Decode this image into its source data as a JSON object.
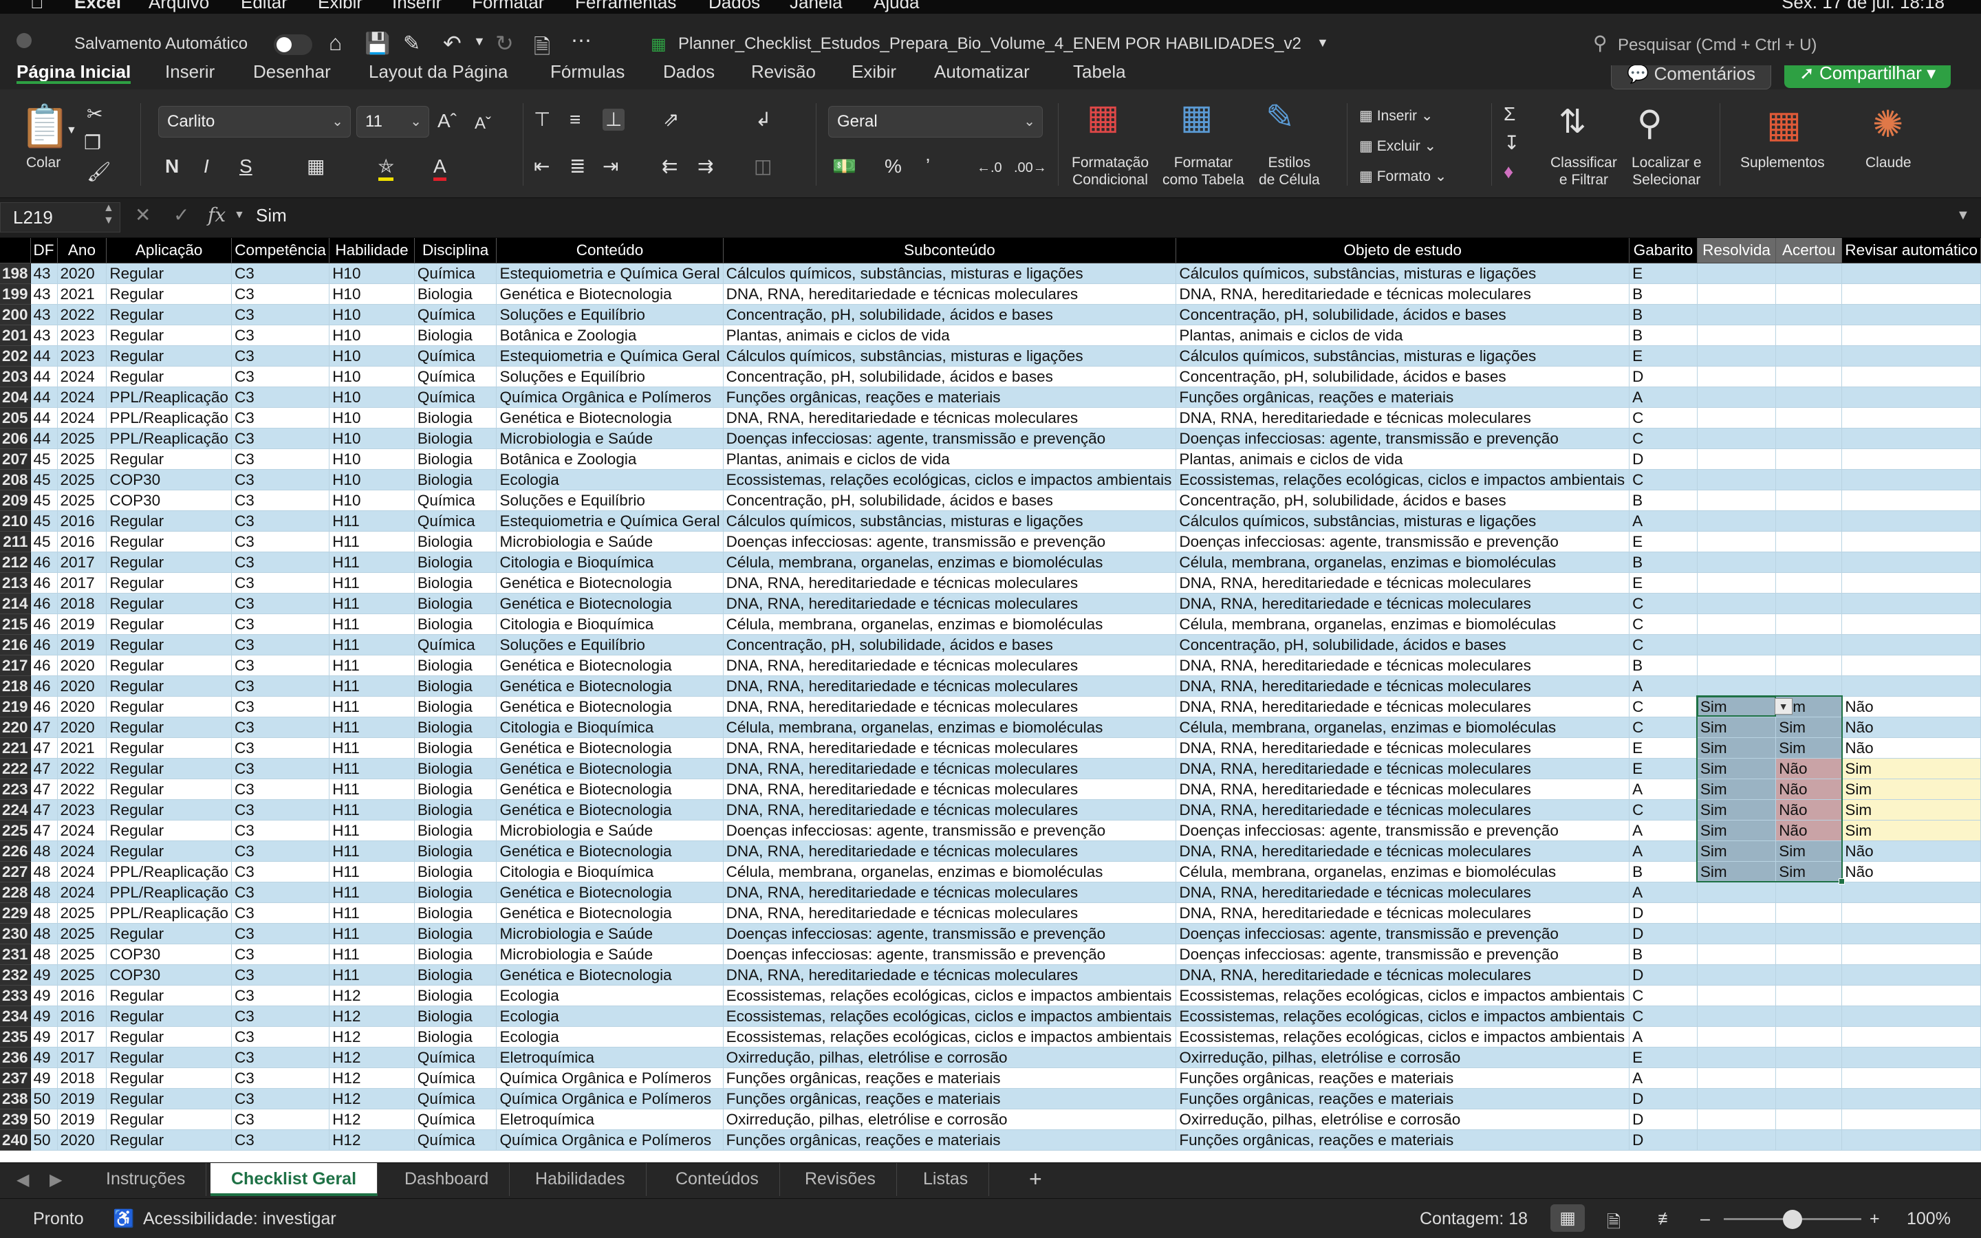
{
  "menubar": {
    "items": [
      "Excel",
      "Arquivo",
      "Editar",
      "Exibir",
      "Inserir",
      "Formatar",
      "Ferramentas",
      "Dados",
      "Janela",
      "Ajuda"
    ],
    "clock": "Sex. 17 de jul. 18:18"
  },
  "titlebar": {
    "autosave_label": "Salvamento Automático",
    "filename": "Planner_Checklist_Estudos_Prepara_Bio_Volume_4_ENEM POR HABILIDADES_v2",
    "search_placeholder": "Pesquisar (Cmd + Ctrl + U)"
  },
  "ribbon_tabs": [
    "Página Inicial",
    "Inserir",
    "Desenhar",
    "Layout da Página",
    "Fórmulas",
    "Dados",
    "Revisão",
    "Exibir",
    "Automatizar",
    "Tabela"
  ],
  "ribbon_actions": {
    "comments": "Comentários",
    "share": "Compartilhar"
  },
  "ribbon": {
    "paste": "Colar",
    "font_name": "Carlito",
    "font_size": "11",
    "number_format": "Geral",
    "bold": "N",
    "italic": "I",
    "underline": "S",
    "cond_format": [
      "Formatação",
      "Condicional"
    ],
    "format_table": [
      "Formatar",
      "como Tabela"
    ],
    "cell_styles": [
      "Estilos",
      "de Célula"
    ],
    "insert": "Inserir",
    "delete": "Excluir",
    "format": "Formato",
    "sort_filter": [
      "Classificar",
      "e Filtrar"
    ],
    "find_select": [
      "Localizar e",
      "Selecionar"
    ],
    "addins": "Suplementos",
    "claude": "Claude"
  },
  "formula_bar": {
    "name_box": "L219",
    "fx": "fx",
    "value": "Sim"
  },
  "columns": [
    "DF",
    "Ano",
    "Aplicação",
    "Competência",
    "Habilidade",
    "Disciplina",
    "Conteúdo",
    "Subconteúdo",
    "Objeto de estudo",
    "Gabarito",
    "Resolvida",
    "Acertou",
    "Revisar automático"
  ],
  "rows": [
    [
      "198",
      "43",
      "2020",
      "Regular",
      "C3",
      "H10",
      "Química",
      "Estequiometria e Química Geral",
      "Cálculos químicos, substâncias, misturas e ligações",
      "Cálculos químicos, substâncias, misturas e ligações",
      "E",
      "",
      "",
      ""
    ],
    [
      "199",
      "43",
      "2021",
      "Regular",
      "C3",
      "H10",
      "Biologia",
      "Genética e Biotecnologia",
      "DNA, RNA, hereditariedade e técnicas moleculares",
      "DNA, RNA, hereditariedade e técnicas moleculares",
      "B",
      "",
      "",
      ""
    ],
    [
      "200",
      "43",
      "2022",
      "Regular",
      "C3",
      "H10",
      "Química",
      "Soluções e Equilíbrio",
      "Concentração, pH, solubilidade, ácidos e bases",
      "Concentração, pH, solubilidade, ácidos e bases",
      "B",
      "",
      "",
      ""
    ],
    [
      "201",
      "43",
      "2023",
      "Regular",
      "C3",
      "H10",
      "Biologia",
      "Botânica e Zoologia",
      "Plantas, animais e ciclos de vida",
      "Plantas, animais e ciclos de vida",
      "B",
      "",
      "",
      ""
    ],
    [
      "202",
      "44",
      "2023",
      "Regular",
      "C3",
      "H10",
      "Química",
      "Estequiometria e Química Geral",
      "Cálculos químicos, substâncias, misturas e ligações",
      "Cálculos químicos, substâncias, misturas e ligações",
      "E",
      "",
      "",
      ""
    ],
    [
      "203",
      "44",
      "2024",
      "Regular",
      "C3",
      "H10",
      "Química",
      "Soluções e Equilíbrio",
      "Concentração, pH, solubilidade, ácidos e bases",
      "Concentração, pH, solubilidade, ácidos e bases",
      "D",
      "",
      "",
      ""
    ],
    [
      "204",
      "44",
      "2024",
      "PPL/Reaplicação",
      "C3",
      "H10",
      "Química",
      "Química Orgânica e Polímeros",
      "Funções orgânicas, reações e materiais",
      "Funções orgânicas, reações e materiais",
      "A",
      "",
      "",
      ""
    ],
    [
      "205",
      "44",
      "2024",
      "PPL/Reaplicação",
      "C3",
      "H10",
      "Biologia",
      "Genética e Biotecnologia",
      "DNA, RNA, hereditariedade e técnicas moleculares",
      "DNA, RNA, hereditariedade e técnicas moleculares",
      "C",
      "",
      "",
      ""
    ],
    [
      "206",
      "44",
      "2025",
      "PPL/Reaplicação",
      "C3",
      "H10",
      "Biologia",
      "Microbiologia e Saúde",
      "Doenças infecciosas: agente, transmissão e prevenção",
      "Doenças infecciosas: agente, transmissão e prevenção",
      "C",
      "",
      "",
      ""
    ],
    [
      "207",
      "45",
      "2025",
      "Regular",
      "C3",
      "H10",
      "Biologia",
      "Botânica e Zoologia",
      "Plantas, animais e ciclos de vida",
      "Plantas, animais e ciclos de vida",
      "D",
      "",
      "",
      ""
    ],
    [
      "208",
      "45",
      "2025",
      "COP30",
      "C3",
      "H10",
      "Biologia",
      "Ecologia",
      "Ecossistemas, relações ecológicas, ciclos e impactos ambientais",
      "Ecossistemas, relações ecológicas, ciclos e impactos ambientais",
      "C",
      "",
      "",
      ""
    ],
    [
      "209",
      "45",
      "2025",
      "COP30",
      "C3",
      "H10",
      "Química",
      "Soluções e Equilíbrio",
      "Concentração, pH, solubilidade, ácidos e bases",
      "Concentração, pH, solubilidade, ácidos e bases",
      "B",
      "",
      "",
      ""
    ],
    [
      "210",
      "45",
      "2016",
      "Regular",
      "C3",
      "H11",
      "Química",
      "Estequiometria e Química Geral",
      "Cálculos químicos, substâncias, misturas e ligações",
      "Cálculos químicos, substâncias, misturas e ligações",
      "A",
      "",
      "",
      ""
    ],
    [
      "211",
      "45",
      "2016",
      "Regular",
      "C3",
      "H11",
      "Biologia",
      "Microbiologia e Saúde",
      "Doenças infecciosas: agente, transmissão e prevenção",
      "Doenças infecciosas: agente, transmissão e prevenção",
      "E",
      "",
      "",
      ""
    ],
    [
      "212",
      "46",
      "2017",
      "Regular",
      "C3",
      "H11",
      "Biologia",
      "Citologia e Bioquímica",
      "Célula, membrana, organelas, enzimas e biomoléculas",
      "Célula, membrana, organelas, enzimas e biomoléculas",
      "B",
      "",
      "",
      ""
    ],
    [
      "213",
      "46",
      "2017",
      "Regular",
      "C3",
      "H11",
      "Biologia",
      "Genética e Biotecnologia",
      "DNA, RNA, hereditariedade e técnicas moleculares",
      "DNA, RNA, hereditariedade e técnicas moleculares",
      "E",
      "",
      "",
      ""
    ],
    [
      "214",
      "46",
      "2018",
      "Regular",
      "C3",
      "H11",
      "Biologia",
      "Genética e Biotecnologia",
      "DNA, RNA, hereditariedade e técnicas moleculares",
      "DNA, RNA, hereditariedade e técnicas moleculares",
      "C",
      "",
      "",
      ""
    ],
    [
      "215",
      "46",
      "2019",
      "Regular",
      "C3",
      "H11",
      "Biologia",
      "Citologia e Bioquímica",
      "Célula, membrana, organelas, enzimas e biomoléculas",
      "Célula, membrana, organelas, enzimas e biomoléculas",
      "C",
      "",
      "",
      ""
    ],
    [
      "216",
      "46",
      "2019",
      "Regular",
      "C3",
      "H11",
      "Química",
      "Soluções e Equilíbrio",
      "Concentração, pH, solubilidade, ácidos e bases",
      "Concentração, pH, solubilidade, ácidos e bases",
      "C",
      "",
      "",
      ""
    ],
    [
      "217",
      "46",
      "2020",
      "Regular",
      "C3",
      "H11",
      "Biologia",
      "Genética e Biotecnologia",
      "DNA, RNA, hereditariedade e técnicas moleculares",
      "DNA, RNA, hereditariedade e técnicas moleculares",
      "B",
      "",
      "",
      ""
    ],
    [
      "218",
      "46",
      "2020",
      "Regular",
      "C3",
      "H11",
      "Biologia",
      "Genética e Biotecnologia",
      "DNA, RNA, hereditariedade e técnicas moleculares",
      "DNA, RNA, hereditariedade e técnicas moleculares",
      "A",
      "",
      "",
      ""
    ],
    [
      "219",
      "46",
      "2020",
      "Regular",
      "C3",
      "H11",
      "Biologia",
      "Genética e Biotecnologia",
      "DNA, RNA, hereditariedade e técnicas moleculares",
      "DNA, RNA, hereditariedade e técnicas moleculares",
      "C",
      "Sim",
      "Sim",
      "Não"
    ],
    [
      "220",
      "47",
      "2020",
      "Regular",
      "C3",
      "H11",
      "Biologia",
      "Citologia e Bioquímica",
      "Célula, membrana, organelas, enzimas e biomoléculas",
      "Célula, membrana, organelas, enzimas e biomoléculas",
      "C",
      "Sim",
      "Sim",
      "Não"
    ],
    [
      "221",
      "47",
      "2021",
      "Regular",
      "C3",
      "H11",
      "Biologia",
      "Genética e Biotecnologia",
      "DNA, RNA, hereditariedade e técnicas moleculares",
      "DNA, RNA, hereditariedade e técnicas moleculares",
      "E",
      "Sim",
      "Sim",
      "Não"
    ],
    [
      "222",
      "47",
      "2022",
      "Regular",
      "C3",
      "H11",
      "Biologia",
      "Genética e Biotecnologia",
      "DNA, RNA, hereditariedade e técnicas moleculares",
      "DNA, RNA, hereditariedade e técnicas moleculares",
      "E",
      "Sim",
      "Não",
      "Sim"
    ],
    [
      "223",
      "47",
      "2022",
      "Regular",
      "C3",
      "H11",
      "Biologia",
      "Genética e Biotecnologia",
      "DNA, RNA, hereditariedade e técnicas moleculares",
      "DNA, RNA, hereditariedade e técnicas moleculares",
      "A",
      "Sim",
      "Não",
      "Sim"
    ],
    [
      "224",
      "47",
      "2023",
      "Regular",
      "C3",
      "H11",
      "Biologia",
      "Genética e Biotecnologia",
      "DNA, RNA, hereditariedade e técnicas moleculares",
      "DNA, RNA, hereditariedade e técnicas moleculares",
      "C",
      "Sim",
      "Não",
      "Sim"
    ],
    [
      "225",
      "47",
      "2024",
      "Regular",
      "C3",
      "H11",
      "Biologia",
      "Microbiologia e Saúde",
      "Doenças infecciosas: agente, transmissão e prevenção",
      "Doenças infecciosas: agente, transmissão e prevenção",
      "A",
      "Sim",
      "Não",
      "Sim"
    ],
    [
      "226",
      "48",
      "2024",
      "Regular",
      "C3",
      "H11",
      "Biologia",
      "Genética e Biotecnologia",
      "DNA, RNA, hereditariedade e técnicas moleculares",
      "DNA, RNA, hereditariedade e técnicas moleculares",
      "A",
      "Sim",
      "Sim",
      "Não"
    ],
    [
      "227",
      "48",
      "2024",
      "PPL/Reaplicação",
      "C3",
      "H11",
      "Biologia",
      "Citologia e Bioquímica",
      "Célula, membrana, organelas, enzimas e biomoléculas",
      "Célula, membrana, organelas, enzimas e biomoléculas",
      "B",
      "Sim",
      "Sim",
      "Não"
    ],
    [
      "228",
      "48",
      "2024",
      "PPL/Reaplicação",
      "C3",
      "H11",
      "Biologia",
      "Genética e Biotecnologia",
      "DNA, RNA, hereditariedade e técnicas moleculares",
      "DNA, RNA, hereditariedade e técnicas moleculares",
      "A",
      "",
      "",
      ""
    ],
    [
      "229",
      "48",
      "2025",
      "PPL/Reaplicação",
      "C3",
      "H11",
      "Biologia",
      "Genética e Biotecnologia",
      "DNA, RNA, hereditariedade e técnicas moleculares",
      "DNA, RNA, hereditariedade e técnicas moleculares",
      "D",
      "",
      "",
      ""
    ],
    [
      "230",
      "48",
      "2025",
      "Regular",
      "C3",
      "H11",
      "Biologia",
      "Microbiologia e Saúde",
      "Doenças infecciosas: agente, transmissão e prevenção",
      "Doenças infecciosas: agente, transmissão e prevenção",
      "D",
      "",
      "",
      ""
    ],
    [
      "231",
      "48",
      "2025",
      "COP30",
      "C3",
      "H11",
      "Biologia",
      "Microbiologia e Saúde",
      "Doenças infecciosas: agente, transmissão e prevenção",
      "Doenças infecciosas: agente, transmissão e prevenção",
      "B",
      "",
      "",
      ""
    ],
    [
      "232",
      "49",
      "2025",
      "COP30",
      "C3",
      "H11",
      "Biologia",
      "Genética e Biotecnologia",
      "DNA, RNA, hereditariedade e técnicas moleculares",
      "DNA, RNA, hereditariedade e técnicas moleculares",
      "D",
      "",
      "",
      ""
    ],
    [
      "233",
      "49",
      "2016",
      "Regular",
      "C3",
      "H12",
      "Biologia",
      "Ecologia",
      "Ecossistemas, relações ecológicas, ciclos e impactos ambientais",
      "Ecossistemas, relações ecológicas, ciclos e impactos ambientais",
      "C",
      "",
      "",
      ""
    ],
    [
      "234",
      "49",
      "2016",
      "Regular",
      "C3",
      "H12",
      "Biologia",
      "Ecologia",
      "Ecossistemas, relações ecológicas, ciclos e impactos ambientais",
      "Ecossistemas, relações ecológicas, ciclos e impactos ambientais",
      "C",
      "",
      "",
      ""
    ],
    [
      "235",
      "49",
      "2017",
      "Regular",
      "C3",
      "H12",
      "Biologia",
      "Ecologia",
      "Ecossistemas, relações ecológicas, ciclos e impactos ambientais",
      "Ecossistemas, relações ecológicas, ciclos e impactos ambientais",
      "A",
      "",
      "",
      ""
    ],
    [
      "236",
      "49",
      "2017",
      "Regular",
      "C3",
      "H12",
      "Química",
      "Eletroquímica",
      "Oxirredução, pilhas, eletrólise e corrosão",
      "Oxirredução, pilhas, eletrólise e corrosão",
      "E",
      "",
      "",
      ""
    ],
    [
      "237",
      "49",
      "2018",
      "Regular",
      "C3",
      "H12",
      "Química",
      "Química Orgânica e Polímeros",
      "Funções orgânicas, reações e materiais",
      "Funções orgânicas, reações e materiais",
      "A",
      "",
      "",
      ""
    ],
    [
      "238",
      "50",
      "2019",
      "Regular",
      "C3",
      "H12",
      "Química",
      "Química Orgânica e Polímeros",
      "Funções orgânicas, reações e materiais",
      "Funções orgânicas, reações e materiais",
      "D",
      "",
      "",
      ""
    ],
    [
      "239",
      "50",
      "2019",
      "Regular",
      "C3",
      "H12",
      "Química",
      "Eletroquímica",
      "Oxirredução, pilhas, eletrólise e corrosão",
      "Oxirredução, pilhas, eletrólise e corrosão",
      "D",
      "",
      "",
      ""
    ],
    [
      "240",
      "50",
      "2020",
      "Regular",
      "C3",
      "H12",
      "Química",
      "Química Orgânica e Polímeros",
      "Funções orgânicas, reações e materiais",
      "Funções orgânicas, reações e materiais",
      "D",
      "",
      "",
      ""
    ]
  ],
  "sheet_tabs": [
    "Instruções",
    "Checklist Geral",
    "Dashboard",
    "Habilidades",
    "Conteúdos",
    "Revisões",
    "Listas"
  ],
  "active_sheet": "Checklist Geral",
  "add_sheet": "+",
  "status": {
    "ready": "Pronto",
    "accessibility": "Acessibilidade: investigar",
    "count": "Contagem: 18",
    "zoom": "100%",
    "zoom_fraction": 0.5
  },
  "colors": {
    "row_alt": "#c6e0ef",
    "select_border": "#1e7145",
    "share_green": "#2ea043"
  }
}
